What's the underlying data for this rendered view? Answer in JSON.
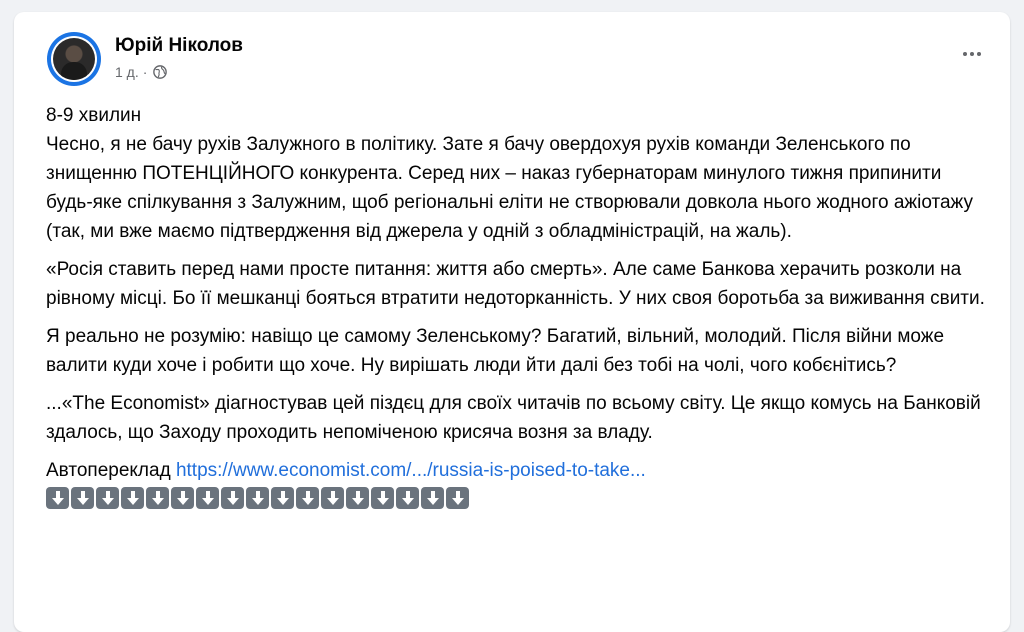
{
  "post": {
    "author": "Юрій Ніколов",
    "time": "1 д.",
    "meta_separator": "·",
    "paragraphs": [
      "8-9 хвилин",
      "Чесно, я не бачу рухів Залужного в політику. Зате я бачу овердохуя рухів команди Зеленського по знищенню ПОТЕНЦІЙНОГО конкурента. Серед них – наказ губернаторам минулого тижня припинити будь-яке спілкування з Залужним, щоб регіональні еліти не створювали довкола нього жодного ажіотажу (так, ми вже маємо підтвердження від джерела у одній з обладміністрацій, на жаль).",
      "«Росія ставить перед нами просте питання: життя або смерть». Але саме Банкова херачить розколи на рівному місці. Бо її мешканці бояться втратити недоторканність. У них своя боротьба за виживання свити.",
      "Я реально не розумію: навіщо це самому Зеленському? Багатий, вільний, молодий. Після війни може валити куди хоче і робити що хоче. Ну вирішать люди йти далі без тобі на чолі, чого кобєнітись?",
      "...«The Economist» діагностував цей піздєц для своїх читачів по всьому світу. Це якщо комусь на Банковій здалось, що Заходу проходить непоміченою крисяча возня за владу."
    ],
    "autotranslate_label": "Автопереклад",
    "link_text": "https://www.economist.com/.../russia-is-poised-to-take...",
    "arrow_emoji_count": 17
  },
  "colors": {
    "link": "#216fdb",
    "meta": "#65676b",
    "avatar_ring": "#1b74e4"
  },
  "icons": {
    "globe": "globe-icon",
    "more": "more-options-icon",
    "arrow": "arrow-down-icon"
  }
}
